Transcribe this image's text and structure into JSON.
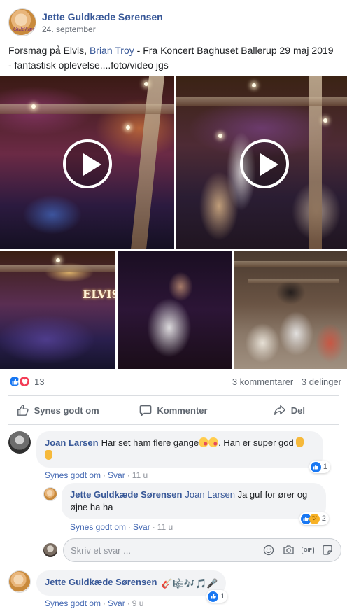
{
  "post": {
    "author": "Jette Guldkæde Sørensen",
    "avatar_caption": "Guldkæde",
    "date": "24. september",
    "text_before": "Forsmag på Elvis, ",
    "mention": "Brian Troy",
    "text_after": " - Fra Koncert Baghuset Ballerup 29 maj 2019 - fantastisk oplevelse....foto/video jgs",
    "sign_text": "ELVIS"
  },
  "reactions": {
    "count": "13",
    "comments": "3 kommentarer",
    "shares": "3 delinger",
    "like_color": "#1877f2",
    "love_color": "#f33e58"
  },
  "actions": {
    "like": "Synes godt om",
    "comment": "Kommenter",
    "share": "Del"
  },
  "comments": [
    {
      "author": "Joan Larsen",
      "text": "Har set ham flere gange",
      "text_after": ". Han er super god",
      "like_label": "Synes godt om",
      "reply_label": "Svar",
      "time": "11 u",
      "reaction_count": "1"
    },
    {
      "author": "Jette Guldkæde Sørensen",
      "tag": "Joan Larsen",
      "text": "Ja guf for ører og øjne ha ha",
      "like_label": "Synes godt om",
      "reply_label": "Svar",
      "time": "11 u",
      "reaction_count": "2"
    },
    {
      "author": "Jette Guldkæde Sørensen",
      "text": "🎸🎼🎶🎵🎤",
      "like_label": "Synes godt om",
      "reply_label": "Svar",
      "time": "9 u",
      "reaction_count": "1"
    }
  ],
  "reply_box": {
    "placeholder": "Skriv et svar ...",
    "icons": [
      "emoji-icon",
      "camera-icon",
      "gif-icon",
      "sticker-icon"
    ],
    "gif_label": "GIF"
  }
}
